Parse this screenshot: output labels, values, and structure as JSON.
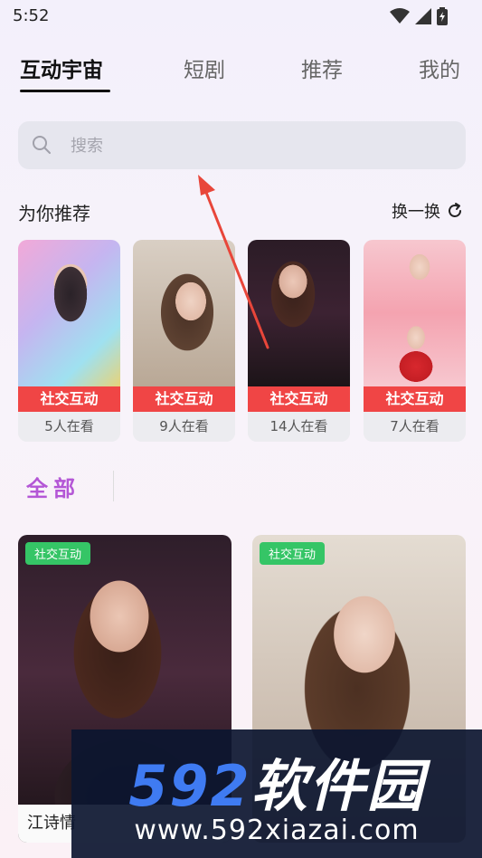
{
  "status": {
    "time": "5:52"
  },
  "tabs": [
    {
      "label": "互动宇宙",
      "active": true
    },
    {
      "label": "短剧",
      "active": false
    },
    {
      "label": "推荐",
      "active": false
    },
    {
      "label": "我的",
      "active": false
    }
  ],
  "search": {
    "placeholder": "搜索",
    "icon": "search-icon"
  },
  "recommend": {
    "title": "为你推荐",
    "refresh_label": "换一换",
    "refresh_icon": "refresh-icon",
    "cards": [
      {
        "tag": "社交互动",
        "viewers": "5人在看"
      },
      {
        "tag": "社交互动",
        "viewers": "9人在看"
      },
      {
        "tag": "社交互动",
        "viewers": "14人在看"
      },
      {
        "tag": "社交互动",
        "viewers": "7人在看"
      }
    ]
  },
  "all": {
    "title": "全部"
  },
  "feed": [
    {
      "tag": "社交互动",
      "name": "江诗情"
    },
    {
      "tag": "社交互动",
      "name": ""
    }
  ],
  "watermark": {
    "brand_number": "592",
    "brand_cn": "软件园",
    "url": "www.592xiazai.com"
  },
  "colors": {
    "tag_red": "#f04545",
    "tag_green": "#35c566",
    "accent_purple": "#b457d6",
    "annotation_arrow": "#e8463a"
  }
}
